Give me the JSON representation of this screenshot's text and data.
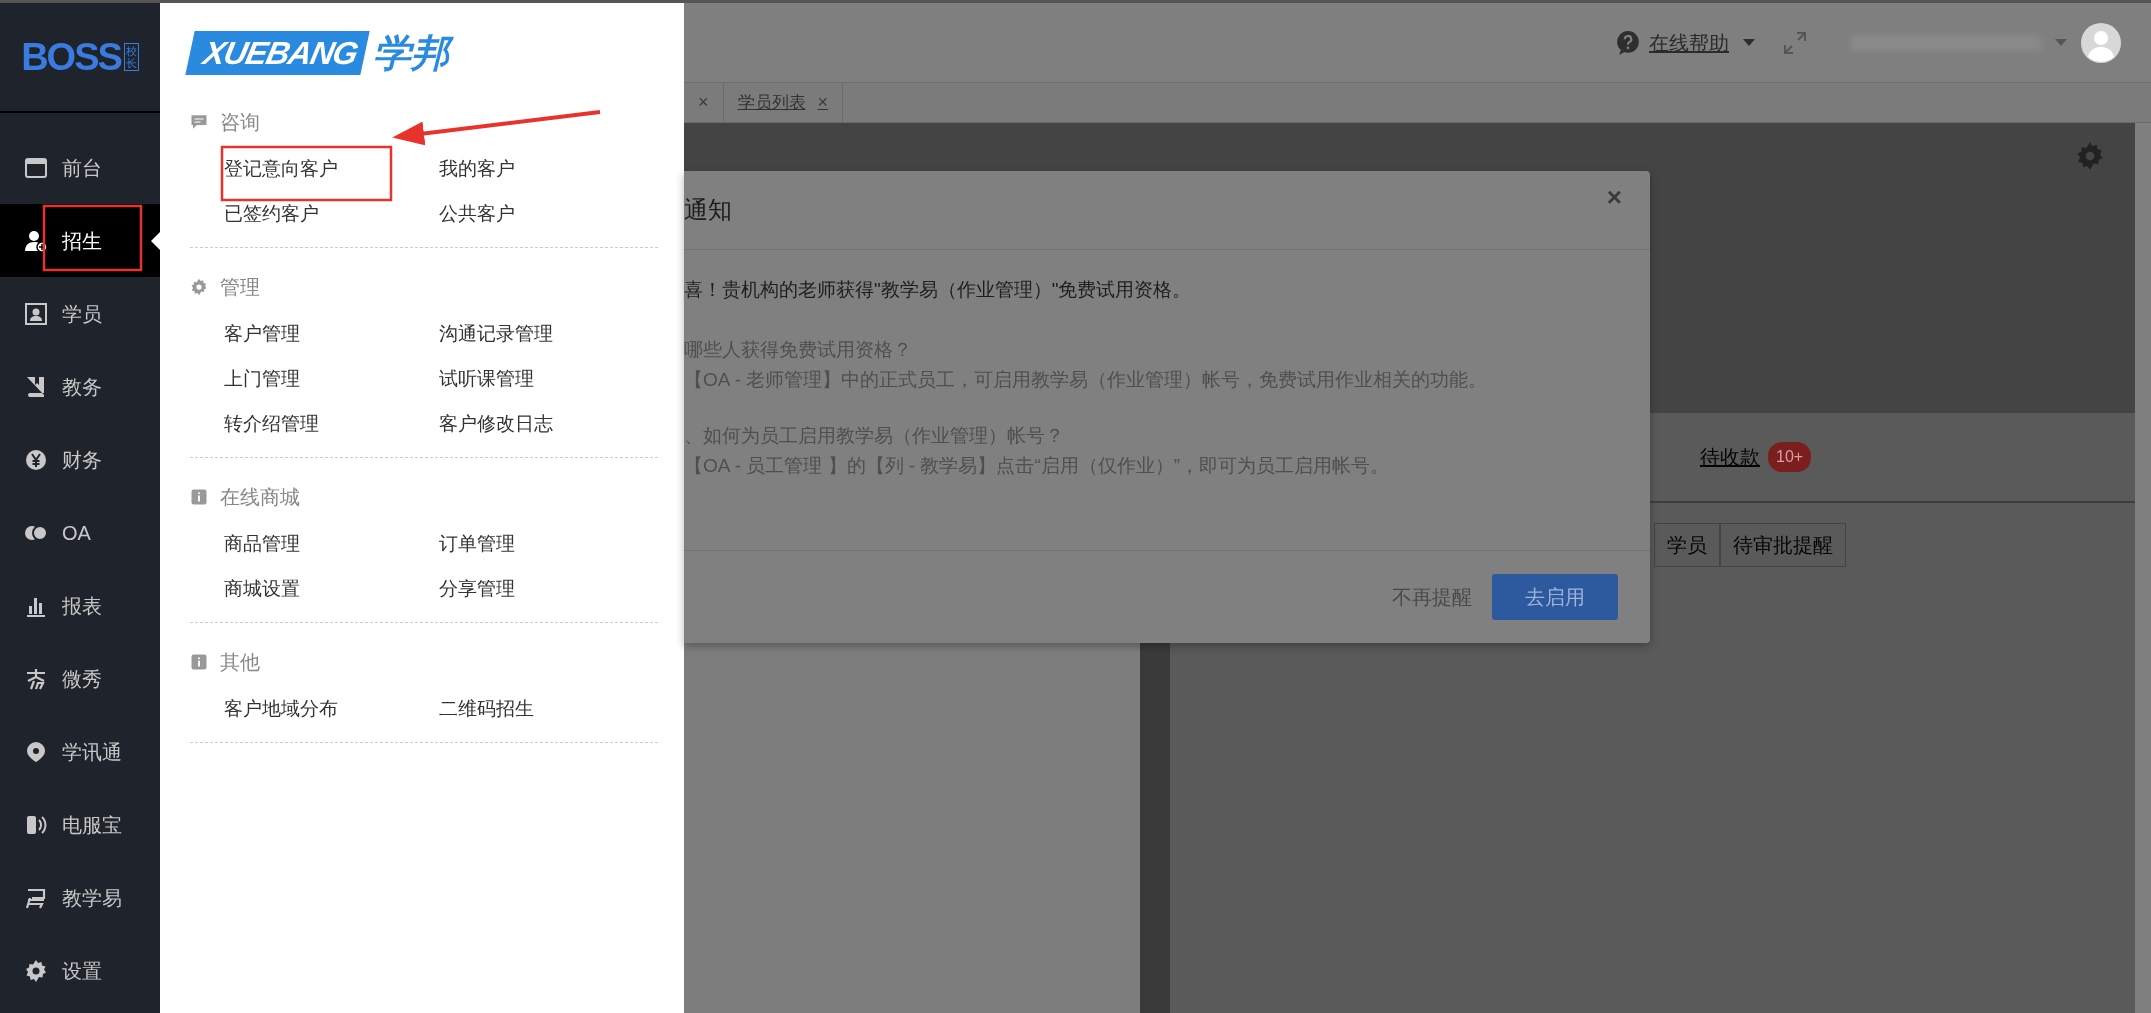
{
  "sidebar": {
    "logo": {
      "text": "BOSS",
      "badge": "校长"
    },
    "items": [
      {
        "label": "前台",
        "selected": false
      },
      {
        "label": "招生",
        "selected": true
      },
      {
        "label": "学员",
        "selected": false
      },
      {
        "label": "教务",
        "selected": false
      },
      {
        "label": "财务",
        "selected": false
      },
      {
        "label": "OA",
        "selected": false
      },
      {
        "label": "报表",
        "selected": false
      },
      {
        "label": "微秀",
        "selected": false
      },
      {
        "label": "学讯通",
        "selected": false
      },
      {
        "label": "电服宝",
        "selected": false
      },
      {
        "label": "教学易",
        "selected": false
      },
      {
        "label": "设置",
        "selected": false
      }
    ]
  },
  "menu": {
    "logo": {
      "latin": "XUEBANG",
      "chinese": "学邦"
    },
    "sections": [
      {
        "title": "咨询",
        "items": [
          "登记意向客户",
          "我的客户",
          "已签约客户",
          "公共客户"
        ]
      },
      {
        "title": "管理",
        "items": [
          "客户管理",
          "沟通记录管理",
          "上门管理",
          "试听课管理",
          "转介绍管理",
          "客户修改日志"
        ]
      },
      {
        "title": "在线商城",
        "items": [
          "商品管理",
          "订单管理",
          "商城设置",
          "分享管理"
        ]
      },
      {
        "title": "其他",
        "items": [
          "客户地域分布",
          "二维码招生"
        ]
      }
    ]
  },
  "header": {
    "help": "在线帮助"
  },
  "tabs": [
    {
      "close": "×"
    },
    {
      "label": "学员列表",
      "close": "×"
    }
  ],
  "dialog": {
    "title": "通知",
    "close": "×",
    "headline": "喜！贵机构的老师获得\"教学易（作业管理）\"免费试用资格。",
    "paragraphs": [
      [
        "哪些人获得免费试用资格？",
        "【OA - 老师管理】中的正式员工，可启用教学易（作业管理）帐号，免费试用作业相关的功能。"
      ],
      [
        "、如何为员工启用教学易（作业管理）帐号？",
        "【OA - 员工管理 】的【列 - 教学易】点击“启用（仅作业）”，即可为员工启用帐号。"
      ]
    ],
    "dismiss": "不再提醒",
    "confirm": "去启用"
  },
  "dashboard": {
    "tab": {
      "label": "待收款",
      "badge": "10+"
    },
    "buttons": [
      "学员",
      "待审批提醒"
    ]
  }
}
